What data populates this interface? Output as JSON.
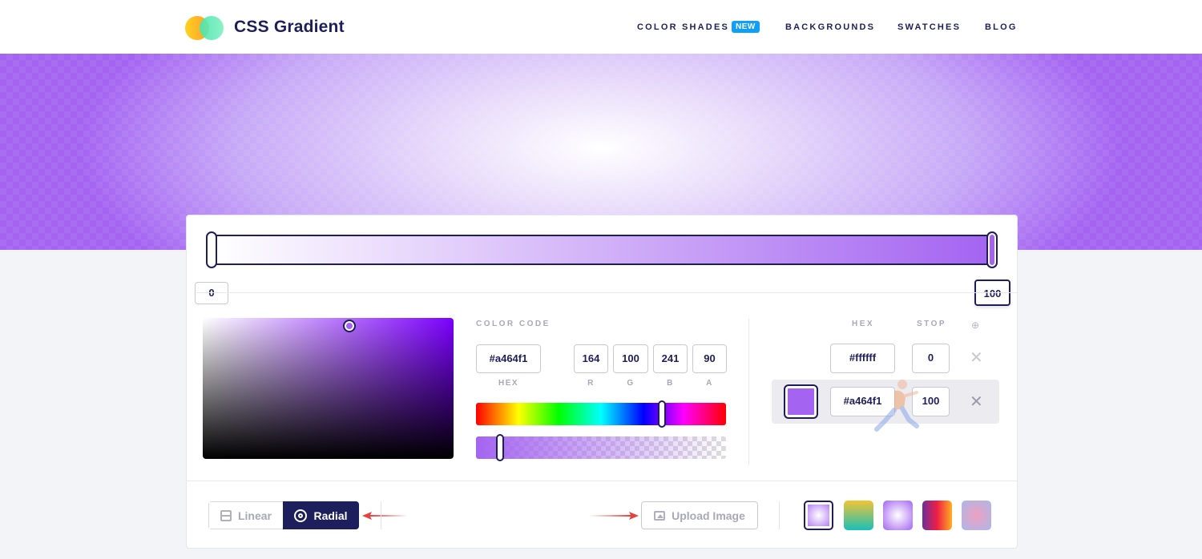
{
  "header": {
    "brand": "CSS Gradient",
    "nav": {
      "color_shades": "COLOR SHADES",
      "new_badge": "NEW",
      "backgrounds": "BACKGROUNDS",
      "swatches": "SWATCHES",
      "blog": "BLOG"
    },
    "logo_icon": "two-circles-logo-icon"
  },
  "gradient": {
    "start_color": "#ffffff",
    "end_color": "#a464f1",
    "stop_left_label": "0",
    "stop_right_label": "100"
  },
  "picker": {
    "color_code_label": "COLOR CODE",
    "hex_value": "#a464f1",
    "hex_label": "HEX",
    "r_value": "164",
    "g_value": "100",
    "b_value": "241",
    "a_value": "90",
    "r_label": "R",
    "g_label": "G",
    "b_label": "B",
    "a_label": "A"
  },
  "stops": {
    "hex_header": "HEX",
    "stop_header": "STOP",
    "add_icon": "plus-circle-icon",
    "rows": [
      {
        "hex": "#ffffff",
        "stop": "0"
      },
      {
        "hex": "#a464f1",
        "stop": "100"
      }
    ],
    "remove_glyph": "✕"
  },
  "bottom": {
    "linear_label": "Linear",
    "radial_label": "Radial",
    "upload_label": "Upload Image"
  },
  "presets": [
    {
      "name": "purple-radial",
      "css": "radial-gradient(circle, #ffffff, #a464f1)"
    },
    {
      "name": "yellow-teal",
      "css": "linear-gradient(180deg, #f3c433, #18c0b8)"
    },
    {
      "name": "violet-radial",
      "css": "radial-gradient(circle, #ffffff, #a464f1)"
    },
    {
      "name": "orange-purple",
      "css": "linear-gradient(90deg, #6c2e9a, #f01e46, #ffb020)"
    },
    {
      "name": "pink-blue",
      "css": "radial-gradient(circle, #f0a0c0, #a8b8ea)"
    }
  ],
  "colors": {
    "navy": "#1d1f5c",
    "accent": "#a464f1",
    "badge": "#0f9ff6",
    "arrow": "#e8403a"
  }
}
